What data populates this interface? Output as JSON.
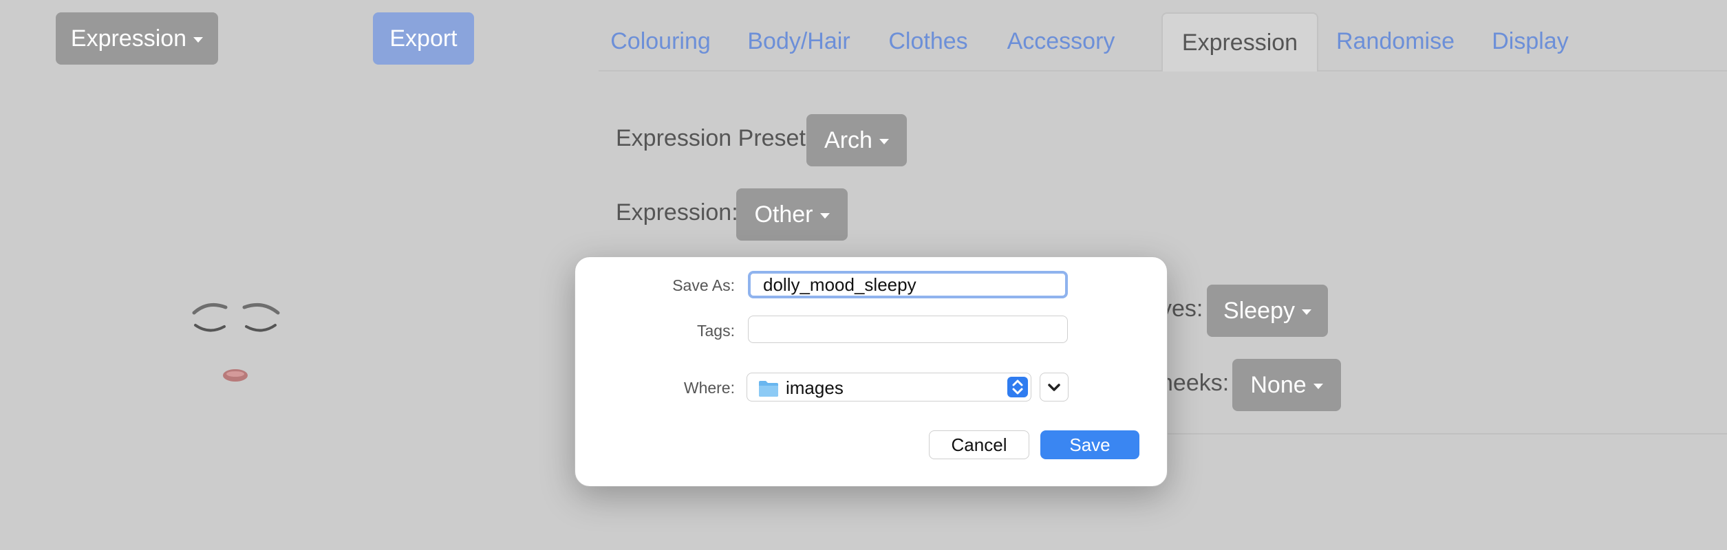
{
  "toolbar": {
    "dropdown_label": "Expression",
    "export_label": "Export"
  },
  "tabs": [
    {
      "label": "Colouring"
    },
    {
      "label": "Body/Hair"
    },
    {
      "label": "Clothes"
    },
    {
      "label": "Accessory"
    },
    {
      "label": "Expression",
      "active": true
    },
    {
      "label": "Randomise"
    },
    {
      "label": "Display"
    }
  ],
  "form": {
    "preset_label": "Expression Preset:",
    "preset_value": "Arch",
    "expression_label": "Expression:",
    "expression_value": "Other",
    "eyes_label_visible": "yes:",
    "eyes_value": "Sleepy",
    "cheeks_label_visible": "heeks:",
    "cheeks_value": "None"
  },
  "dialog": {
    "save_as_label": "Save As:",
    "save_as_value": "dolly_mood_sleepy",
    "tags_label": "Tags:",
    "tags_value": "",
    "where_label": "Where:",
    "where_value": "images",
    "cancel_label": "Cancel",
    "save_label": "Save"
  },
  "colors": {
    "tab_link": "#6c8fd8",
    "save_button": "#3a86f2",
    "gray_button": "#999999"
  }
}
